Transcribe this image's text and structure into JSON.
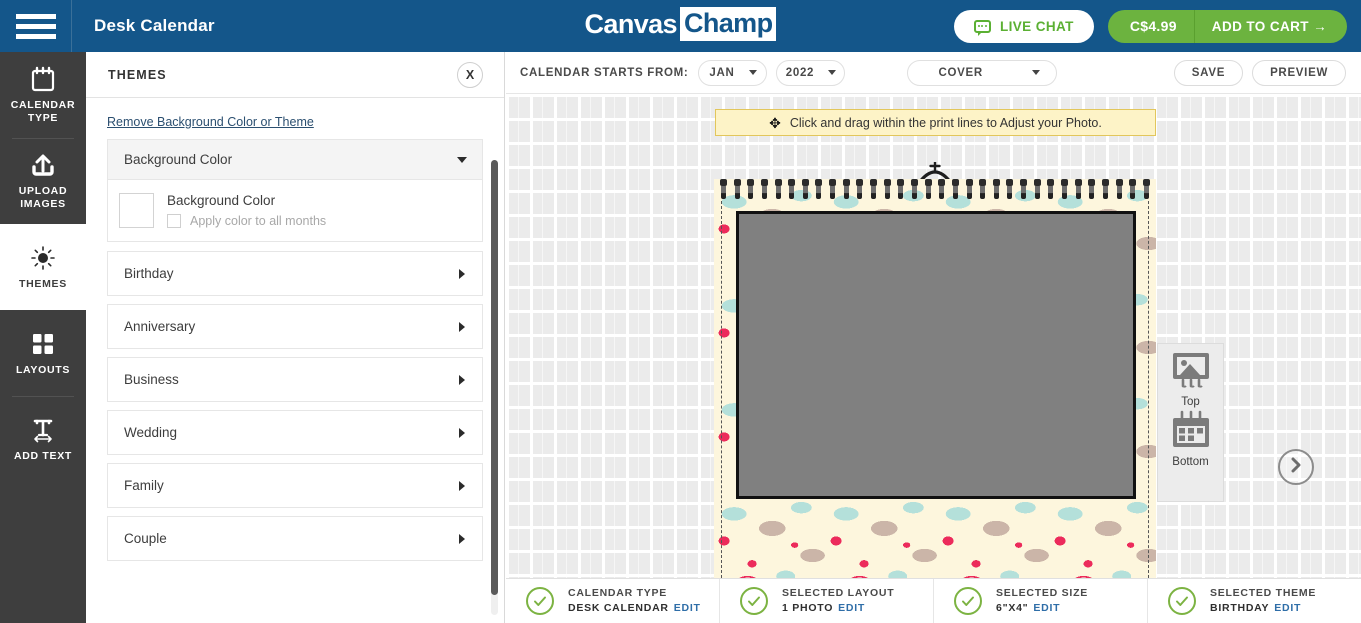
{
  "header": {
    "menu_icon": "hamburger-menu-icon",
    "title": "Desk Calendar",
    "brand_part1": "Canvas",
    "brand_part2": "Champ",
    "live_chat": "LIVE CHAT",
    "live_chat_icon": "chat-bubble-icon",
    "price": "C$4.99",
    "add_to_cart": "ADD TO CART →",
    "bg_color": "#14568a",
    "accent_green": "#6cb33f"
  },
  "rail": {
    "items": [
      {
        "label": "CALENDAR TYPE",
        "icon": "calendar-icon",
        "active": false
      },
      {
        "label": "UPLOAD IMAGES",
        "icon": "upload-icon",
        "active": false
      },
      {
        "label": "THEMES",
        "icon": "sun-theme-icon",
        "active": true
      },
      {
        "label": "LAYOUTS",
        "icon": "grid-layout-icon",
        "active": false
      },
      {
        "label": "ADD TEXT",
        "icon": "text-tool-icon",
        "active": false
      }
    ]
  },
  "panel": {
    "title": "THEMES",
    "close_label": "X",
    "remove_link": "Remove Background Color or Theme",
    "background_color": {
      "header_label": "Background Color",
      "swatch_label": "Background Color",
      "swatch_color": "#ffffff",
      "apply_all_label": "Apply color to all months",
      "apply_all_checked": false
    },
    "categories": [
      {
        "label": "Birthday"
      },
      {
        "label": "Anniversary"
      },
      {
        "label": "Business"
      },
      {
        "label": "Wedding"
      },
      {
        "label": "Family"
      },
      {
        "label": "Couple"
      }
    ]
  },
  "toolbar": {
    "starts_from_label": "CALENDAR STARTS FROM:",
    "month": "JAN",
    "year": "2022",
    "page": "COVER",
    "save": "SAVE",
    "preview": "PREVIEW"
  },
  "stage": {
    "hint": "Click and drag within the print lines to Adjust your Photo.",
    "hint_icon": "move-arrows-icon",
    "hint_bg": "#fdf3c7",
    "sheet_bg": "#fdf6dd",
    "photo_placeholder_color": "#808080",
    "next_icon": "chevron-right-icon"
  },
  "side_palette": {
    "top": {
      "label": "Top",
      "icon": "photo-top-icon"
    },
    "bottom": {
      "label": "Bottom",
      "icon": "calendar-bottom-icon"
    }
  },
  "statusbar": {
    "items": [
      {
        "title": "CALENDAR TYPE",
        "value": "DESK CALENDAR",
        "edit": "EDIT",
        "icon": "check-circle-icon"
      },
      {
        "title": "SELECTED LAYOUT",
        "value": "1 PHOTO",
        "edit": "EDIT",
        "icon": "check-circle-icon"
      },
      {
        "title": "SELECTED SIZE",
        "value": "6\"X4\"",
        "edit": "EDIT",
        "icon": "check-circle-icon"
      },
      {
        "title": "SELECTED THEME",
        "value": "BIRTHDAY",
        "edit": "EDIT",
        "icon": "check-circle-icon"
      }
    ]
  }
}
